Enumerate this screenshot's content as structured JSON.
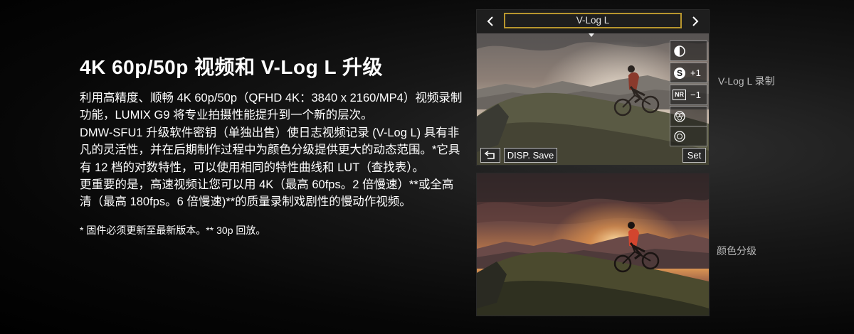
{
  "heading": "4K 60p/50p 视频和 V-Log L 升级",
  "paragraphs": [
    "利用高精度、顺畅 4K 60p/50p（QFHD 4K：3840 x 2160/MP4）视频录制功能，LUMIX G9 将专业拍摄性能提升到一个新的层次。",
    "DMW-SFU1 升级软件密钥（单独出售）使日志视频记录 (V-Log L) 具有非凡的灵活性，并在后期制作过程中为颜色分级提供更大的动态范围。*它具有 12 档的对数特性，可以使用相同的特性曲线和 LUT（查找表）。",
    "更重要的是，高速视频让您可以用 4K（最高 60fps。2 倍慢速）**或全高清（最高 180fps。6 倍慢速)**的质量录制戏剧性的慢动作视频。"
  ],
  "footnote": "* 固件必须更新至最新版本。** 30p 回放。",
  "camera_screen": {
    "mode_label": "V-Log L",
    "side_buttons": [
      {
        "icon": "contrast-icon",
        "value": ""
      },
      {
        "icon": "saturation-icon",
        "value": "+1"
      },
      {
        "icon": "noise-reduction-icon",
        "badge": "NR",
        "value": "−1"
      },
      {
        "icon": "filter-effect-icon",
        "value": ""
      },
      {
        "icon": "shading-icon",
        "value": ""
      }
    ],
    "back_icon": "return-icon",
    "disp_save_label": "DISP. Save",
    "set_label": "Set"
  },
  "captions": {
    "vlog": "V-Log L 录制",
    "grading": "颜色分级"
  },
  "colors": {
    "accent_box": "#b8962e",
    "background": "#000000"
  }
}
